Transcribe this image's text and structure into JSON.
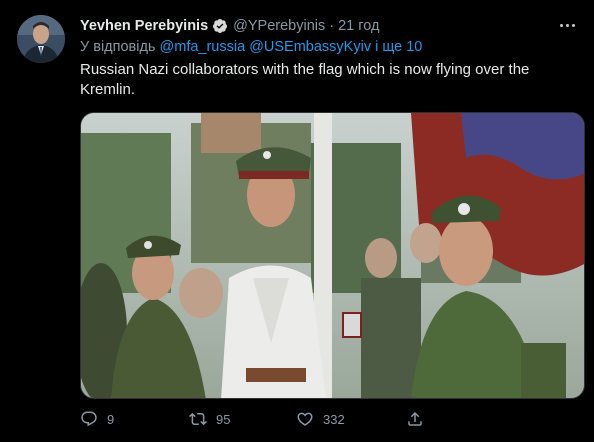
{
  "user": {
    "name": "Yevhen Perebyinis",
    "handle": "@YPerebyinis",
    "separator": "·",
    "time": "21 год"
  },
  "reply": {
    "prefix": "У відповідь",
    "mention1": "@mfa_russia",
    "mention2": "@USEmbassyKyiv",
    "suffix": "і ще 10"
  },
  "tweet": {
    "text": "Russian Nazi collaborators with the flag which is now flying over the Kremlin."
  },
  "actions": {
    "replies": "9",
    "retweets": "95",
    "likes": "332"
  },
  "colors": {
    "background": "#000000",
    "accent": "#1d9bf0",
    "muted": "#8b98a5"
  },
  "icons": {
    "verified": "verified-badge-icon",
    "more": "more-options-icon",
    "reply": "reply-icon",
    "retweet": "retweet-icon",
    "like": "heart-icon",
    "share": "share-icon"
  }
}
